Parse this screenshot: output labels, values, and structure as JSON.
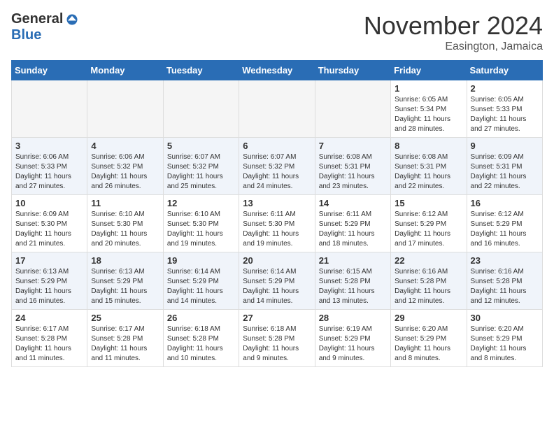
{
  "logo": {
    "general": "General",
    "blue": "Blue"
  },
  "title": "November 2024",
  "subtitle": "Easington, Jamaica",
  "weekdays": [
    "Sunday",
    "Monday",
    "Tuesday",
    "Wednesday",
    "Thursday",
    "Friday",
    "Saturday"
  ],
  "weeks": [
    [
      {
        "day": "",
        "info": ""
      },
      {
        "day": "",
        "info": ""
      },
      {
        "day": "",
        "info": ""
      },
      {
        "day": "",
        "info": ""
      },
      {
        "day": "",
        "info": ""
      },
      {
        "day": "1",
        "info": "Sunrise: 6:05 AM\nSunset: 5:34 PM\nDaylight: 11 hours and 28 minutes."
      },
      {
        "day": "2",
        "info": "Sunrise: 6:05 AM\nSunset: 5:33 PM\nDaylight: 11 hours and 27 minutes."
      }
    ],
    [
      {
        "day": "3",
        "info": "Sunrise: 6:06 AM\nSunset: 5:33 PM\nDaylight: 11 hours and 27 minutes."
      },
      {
        "day": "4",
        "info": "Sunrise: 6:06 AM\nSunset: 5:32 PM\nDaylight: 11 hours and 26 minutes."
      },
      {
        "day": "5",
        "info": "Sunrise: 6:07 AM\nSunset: 5:32 PM\nDaylight: 11 hours and 25 minutes."
      },
      {
        "day": "6",
        "info": "Sunrise: 6:07 AM\nSunset: 5:32 PM\nDaylight: 11 hours and 24 minutes."
      },
      {
        "day": "7",
        "info": "Sunrise: 6:08 AM\nSunset: 5:31 PM\nDaylight: 11 hours and 23 minutes."
      },
      {
        "day": "8",
        "info": "Sunrise: 6:08 AM\nSunset: 5:31 PM\nDaylight: 11 hours and 22 minutes."
      },
      {
        "day": "9",
        "info": "Sunrise: 6:09 AM\nSunset: 5:31 PM\nDaylight: 11 hours and 22 minutes."
      }
    ],
    [
      {
        "day": "10",
        "info": "Sunrise: 6:09 AM\nSunset: 5:30 PM\nDaylight: 11 hours and 21 minutes."
      },
      {
        "day": "11",
        "info": "Sunrise: 6:10 AM\nSunset: 5:30 PM\nDaylight: 11 hours and 20 minutes."
      },
      {
        "day": "12",
        "info": "Sunrise: 6:10 AM\nSunset: 5:30 PM\nDaylight: 11 hours and 19 minutes."
      },
      {
        "day": "13",
        "info": "Sunrise: 6:11 AM\nSunset: 5:30 PM\nDaylight: 11 hours and 19 minutes."
      },
      {
        "day": "14",
        "info": "Sunrise: 6:11 AM\nSunset: 5:29 PM\nDaylight: 11 hours and 18 minutes."
      },
      {
        "day": "15",
        "info": "Sunrise: 6:12 AM\nSunset: 5:29 PM\nDaylight: 11 hours and 17 minutes."
      },
      {
        "day": "16",
        "info": "Sunrise: 6:12 AM\nSunset: 5:29 PM\nDaylight: 11 hours and 16 minutes."
      }
    ],
    [
      {
        "day": "17",
        "info": "Sunrise: 6:13 AM\nSunset: 5:29 PM\nDaylight: 11 hours and 16 minutes."
      },
      {
        "day": "18",
        "info": "Sunrise: 6:13 AM\nSunset: 5:29 PM\nDaylight: 11 hours and 15 minutes."
      },
      {
        "day": "19",
        "info": "Sunrise: 6:14 AM\nSunset: 5:29 PM\nDaylight: 11 hours and 14 minutes."
      },
      {
        "day": "20",
        "info": "Sunrise: 6:14 AM\nSunset: 5:29 PM\nDaylight: 11 hours and 14 minutes."
      },
      {
        "day": "21",
        "info": "Sunrise: 6:15 AM\nSunset: 5:28 PM\nDaylight: 11 hours and 13 minutes."
      },
      {
        "day": "22",
        "info": "Sunrise: 6:16 AM\nSunset: 5:28 PM\nDaylight: 11 hours and 12 minutes."
      },
      {
        "day": "23",
        "info": "Sunrise: 6:16 AM\nSunset: 5:28 PM\nDaylight: 11 hours and 12 minutes."
      }
    ],
    [
      {
        "day": "24",
        "info": "Sunrise: 6:17 AM\nSunset: 5:28 PM\nDaylight: 11 hours and 11 minutes."
      },
      {
        "day": "25",
        "info": "Sunrise: 6:17 AM\nSunset: 5:28 PM\nDaylight: 11 hours and 11 minutes."
      },
      {
        "day": "26",
        "info": "Sunrise: 6:18 AM\nSunset: 5:28 PM\nDaylight: 11 hours and 10 minutes."
      },
      {
        "day": "27",
        "info": "Sunrise: 6:18 AM\nSunset: 5:28 PM\nDaylight: 11 hours and 9 minutes."
      },
      {
        "day": "28",
        "info": "Sunrise: 6:19 AM\nSunset: 5:29 PM\nDaylight: 11 hours and 9 minutes."
      },
      {
        "day": "29",
        "info": "Sunrise: 6:20 AM\nSunset: 5:29 PM\nDaylight: 11 hours and 8 minutes."
      },
      {
        "day": "30",
        "info": "Sunrise: 6:20 AM\nSunset: 5:29 PM\nDaylight: 11 hours and 8 minutes."
      }
    ]
  ]
}
